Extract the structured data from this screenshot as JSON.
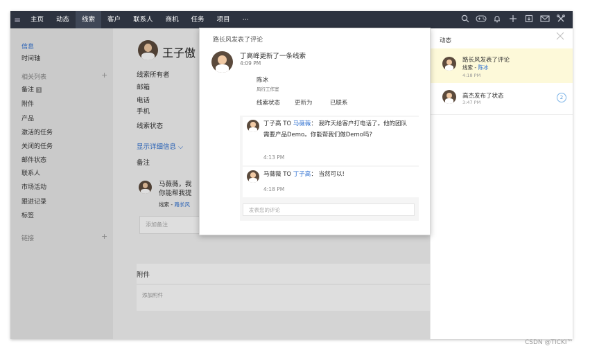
{
  "topbar": {
    "nav": [
      "主页",
      "动态",
      "线索",
      "客户",
      "联系人",
      "商机",
      "任务",
      "项目",
      "⋯"
    ],
    "active_index": 2,
    "tools": [
      "search-icon",
      "gamepad-icon",
      "bell-icon",
      "plus-icon",
      "export-icon",
      "mail-icon",
      "tools-icon"
    ]
  },
  "sidebar": {
    "info": "信息",
    "timeline": "时间轴",
    "related": "相关列表",
    "notes": "备注",
    "notes_badge": "1",
    "attachments": "附件",
    "products": "产品",
    "active_tasks": "激活的任务",
    "closed_tasks": "关闭的任务",
    "mail_status": "邮件状态",
    "contacts": "联系人",
    "marketing": "市场活动",
    "follow_up": "跟进记录",
    "tags": "标签",
    "links": "链接"
  },
  "main": {
    "name": "王子傲",
    "owner_label": "线索所有者",
    "email_label": "邮箱",
    "phone_label": "电话",
    "mobile_label": "手机",
    "status_label": "线索状态",
    "show_details": "显示详细信息 ⌵",
    "notes_title": "备注",
    "note_text_1": "马薇薇，我",
    "note_text_2": "你能帮我提",
    "note_meta_prefix": "线索 - ",
    "note_meta_link": "路长风",
    "add_note_placeholder": "添加备注",
    "attachments_title": "附件",
    "add_attachment_placeholder": "添加附件"
  },
  "popup": {
    "header": "路长风发表了评论",
    "updater": "丁高峰更新了一条线索",
    "update_time": "4:09 PM",
    "lead_name": "陈冰",
    "company": "风行工作室",
    "field": "线索状态",
    "changed_to": "更新为",
    "new_value": "已联系",
    "comment1_from": "丁子高 TO ",
    "comment1_to": "马薇薇",
    "comment1_text_a": "： 我昨天给客户打电话了。他的团队",
    "comment1_text_b": "需要产品Demo。你能帮我们做Demo吗?",
    "comment1_time": "4:13 PM",
    "comment2_from": "马薇薇 TO ",
    "comment2_to": "丁子高",
    "comment2_text": "： 当然可以!",
    "comment2_time": "4:18 PM",
    "reply_placeholder": "发表您的评论"
  },
  "activity": {
    "title": "动态",
    "items": [
      {
        "title": "路长风发表了评论",
        "meta_prefix": "线索 - ",
        "meta_link": "陈冰",
        "time": "4:18 PM"
      },
      {
        "title": "高杰发布了状态",
        "time": "3:47 PM",
        "count": "2"
      }
    ]
  },
  "watermark": "CSDN @TICKI™"
}
